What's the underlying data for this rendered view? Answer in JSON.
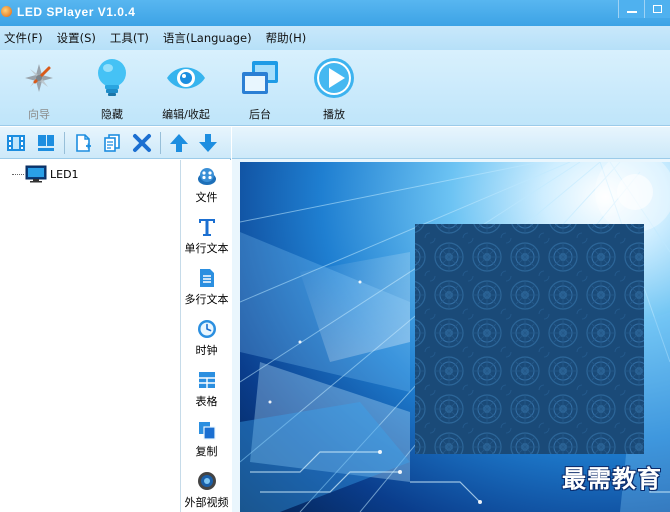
{
  "window": {
    "title": "LED SPlayer V1.0.4"
  },
  "menu": [
    {
      "label": "文件(F)"
    },
    {
      "label": "设置(S)"
    },
    {
      "label": "工具(T)"
    },
    {
      "label": "语言(Language)"
    },
    {
      "label": "帮助(H)"
    }
  ],
  "toolbar": {
    "wizard": {
      "label": "向导",
      "icon": "wand-icon",
      "enabled": false
    },
    "hide": {
      "label": "隐藏",
      "icon": "lightbulb-icon"
    },
    "edit": {
      "label": "编辑/收起",
      "icon": "eye-icon"
    },
    "background": {
      "label": "后台",
      "icon": "windows-icon"
    },
    "play": {
      "label": "播放",
      "icon": "play-icon"
    }
  },
  "mini_toolbar": {
    "items": [
      "film-icon",
      "layout-icon",
      "new-page-icon",
      "copy-page-icon",
      "delete-icon",
      "move-up-icon",
      "move-down-icon"
    ]
  },
  "tree": {
    "root_label": "LED1"
  },
  "side_items": [
    {
      "label": "文件",
      "icon": "film-reel-icon"
    },
    {
      "label": "单行文本",
      "icon": "text-t-icon"
    },
    {
      "label": "多行文本",
      "icon": "document-icon"
    },
    {
      "label": "时钟",
      "icon": "clock-icon"
    },
    {
      "label": "表格",
      "icon": "table-icon"
    },
    {
      "label": "复制",
      "icon": "copy-icon"
    },
    {
      "label": "外部视频",
      "icon": "video-lens-icon"
    }
  ],
  "watermark": {
    "text": "最需教育"
  },
  "colors": {
    "titlebar": "#3ca3e6",
    "accent_blue": "#1d8ee0",
    "delete_blue": "#1b6fd1"
  }
}
